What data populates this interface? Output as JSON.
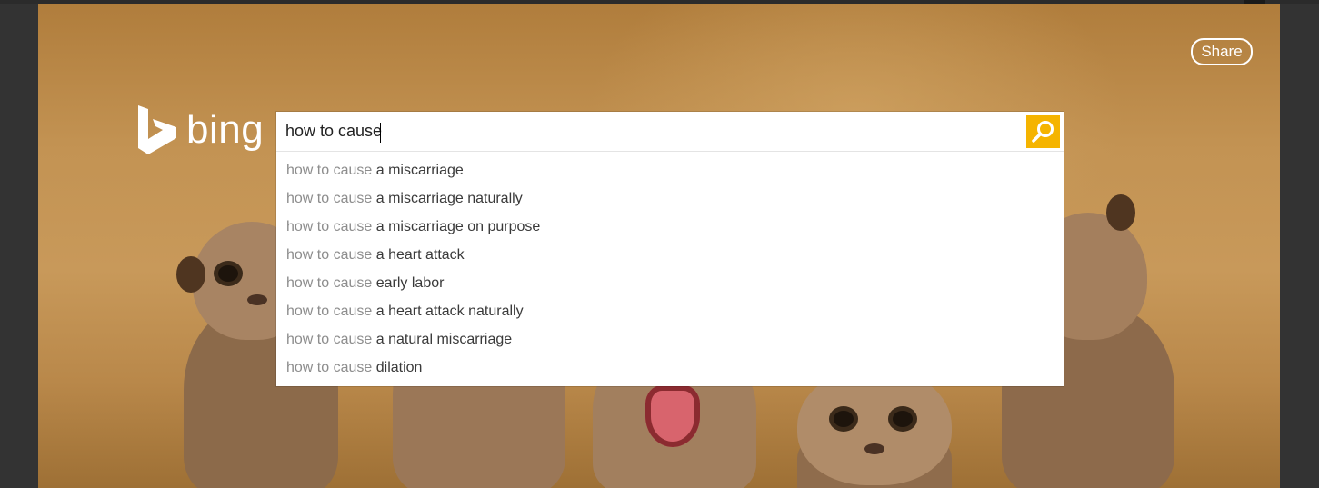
{
  "brand": {
    "logo_text": "bing"
  },
  "header": {
    "share_label": "Share"
  },
  "search": {
    "query": "how to cause",
    "button_icon": "search-icon",
    "suggestions": [
      {
        "prefix": "how to cause",
        "completion": "a miscarriage"
      },
      {
        "prefix": "how to cause",
        "completion": "a miscarriage naturally"
      },
      {
        "prefix": "how to cause",
        "completion": "a miscarriage on purpose"
      },
      {
        "prefix": "how to cause",
        "completion": "a heart attack"
      },
      {
        "prefix": "how to cause",
        "completion": "early labor"
      },
      {
        "prefix": "how to cause",
        "completion": "a heart attack naturally"
      },
      {
        "prefix": "how to cause",
        "completion": "a natural miscarriage"
      },
      {
        "prefix": "how to cause",
        "completion": "dilation"
      }
    ]
  },
  "colors": {
    "accent": "#f5b400",
    "frame": "#333333",
    "background": "#c39353"
  }
}
